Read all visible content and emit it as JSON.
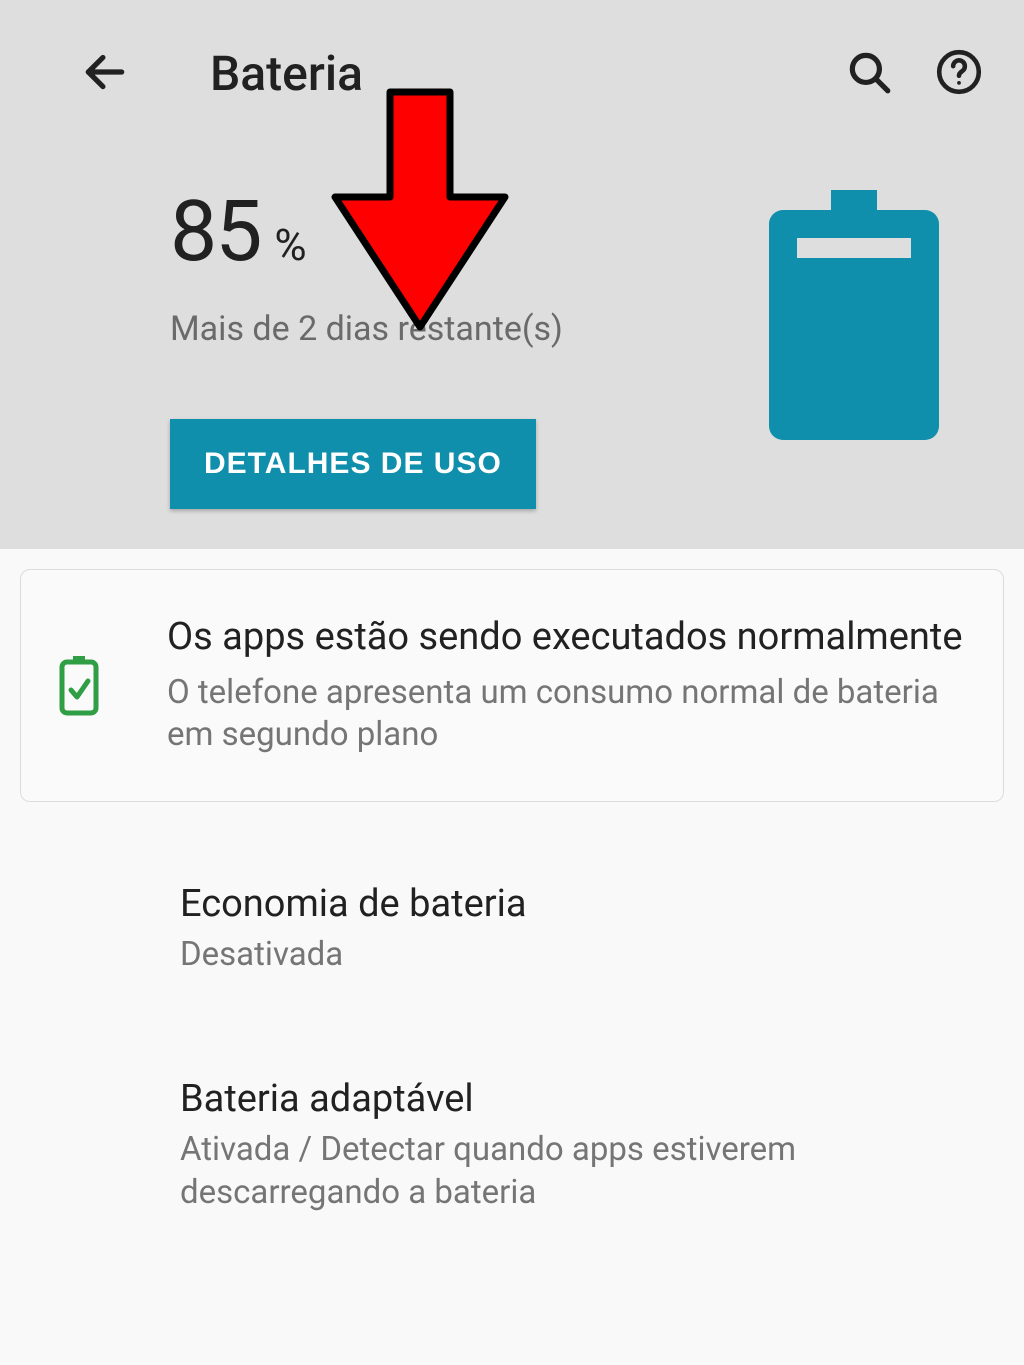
{
  "header": {
    "title": "Bateria"
  },
  "battery": {
    "percent_value": "85",
    "percent_sign": "%",
    "remaining": "Mais de 2 dias restante(s)",
    "usage_button": "DETALHES DE USO",
    "color": "#0f8fac"
  },
  "status_card": {
    "title": "Os apps estão sendo executados normalmente",
    "subtitle": "O telefone apresenta um consumo normal de bateria em segundo plano"
  },
  "settings": [
    {
      "title": "Economia de bateria",
      "subtitle": "Desativada"
    },
    {
      "title": "Bateria adaptável",
      "subtitle": "Ativada / Detectar quando apps estiverem descarregando a bateria"
    }
  ]
}
